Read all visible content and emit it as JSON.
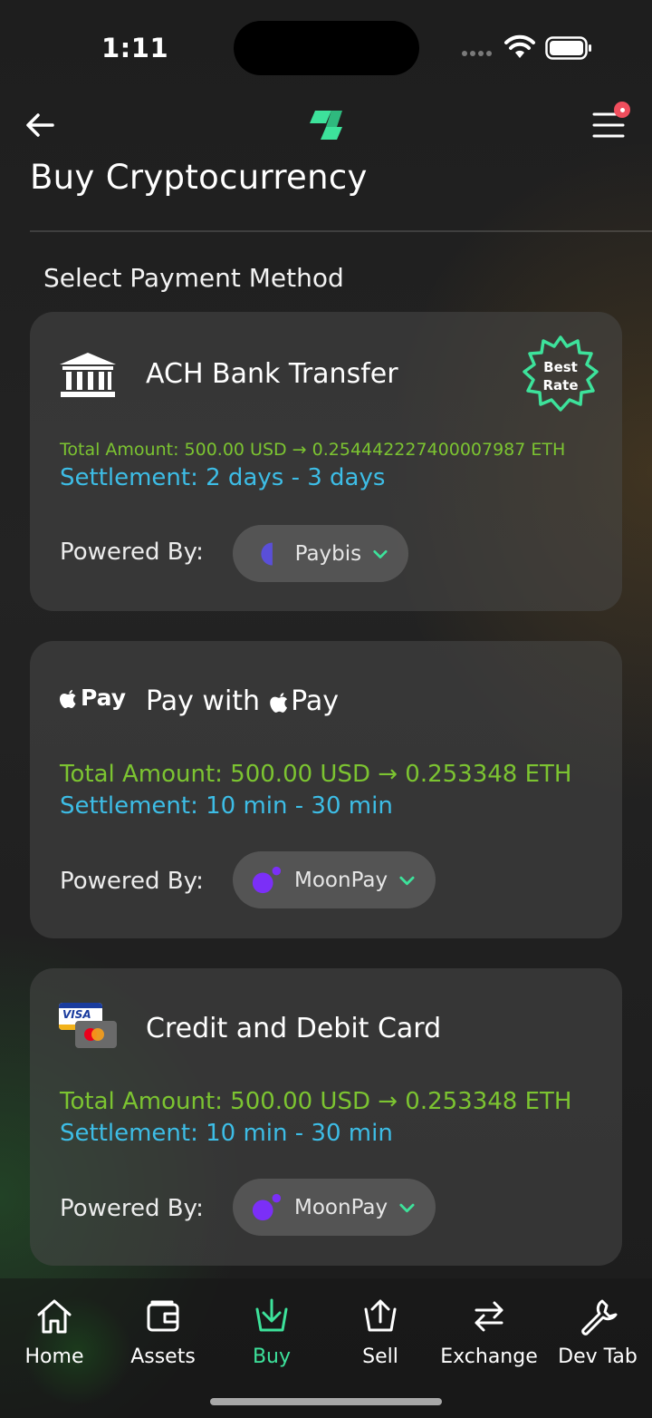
{
  "status_bar": {
    "time": "1:11"
  },
  "header": {
    "title": "Buy Cryptocurrency",
    "logo_color": "#3de29b",
    "notification_color": "#f04e5d"
  },
  "section": {
    "title": "Select Payment Method"
  },
  "payment_methods": [
    {
      "title": "ACH Bank Transfer",
      "icon": "bank-icon",
      "badge": {
        "line1": "Best",
        "line2": "Rate",
        "color": "#3de29b"
      },
      "amount": "Total Amount: 500.00 USD → 0.254442227400007987 ETH",
      "settlement": "Settlement: 2 days - 3 days",
      "powered_label": "Powered By:",
      "provider": "Paybis"
    },
    {
      "title_prefix": "Pay with",
      "title_brand": "Pay",
      "icon": "apple-pay-icon",
      "icon_text": "Pay",
      "amount": "Total Amount: 500.00 USD → 0.253348 ETH",
      "settlement": "Settlement: 10 min - 30 min",
      "powered_label": "Powered By:",
      "provider": "MoonPay"
    },
    {
      "title": "Credit and Debit Card",
      "icon": "card-icon",
      "icon_text": "VISA",
      "amount": "Total Amount: 500.00 USD → 0.253348 ETH",
      "settlement": "Settlement: 10 min - 30 min",
      "powered_label": "Powered By:",
      "provider": "MoonPay"
    }
  ],
  "colors": {
    "amount": "#7cc431",
    "settlement": "#3dbde6",
    "accent": "#3de29b",
    "moonpay": "#7b2ff7",
    "paybis": "#5a4fd8"
  },
  "tabs": [
    {
      "label": "Home",
      "icon": "home-icon",
      "active": false
    },
    {
      "label": "Assets",
      "icon": "wallet-icon",
      "active": false
    },
    {
      "label": "Buy",
      "icon": "buy-icon",
      "active": true
    },
    {
      "label": "Sell",
      "icon": "sell-icon",
      "active": false
    },
    {
      "label": "Exchange",
      "icon": "exchange-icon",
      "active": false
    },
    {
      "label": "Dev Tab",
      "icon": "wrench-icon",
      "active": false
    }
  ]
}
